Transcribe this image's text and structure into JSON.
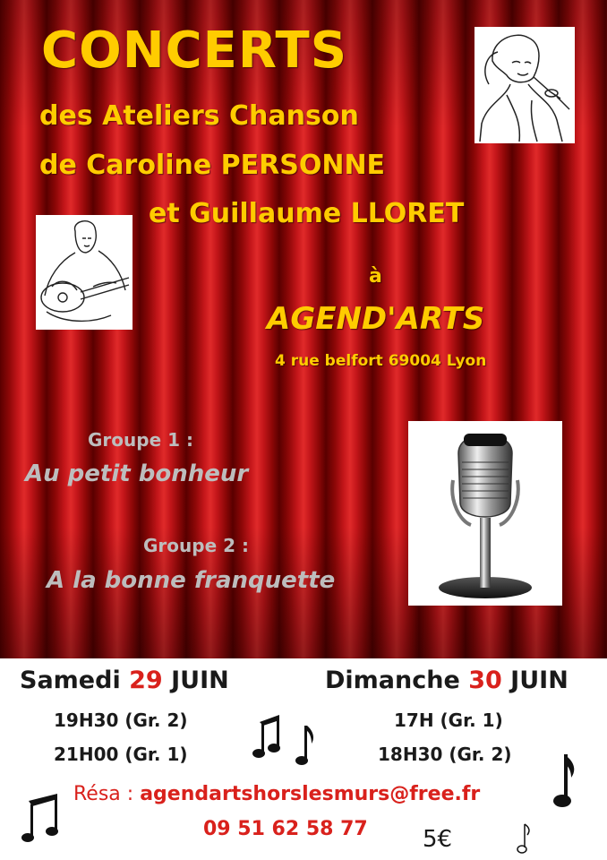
{
  "header": {
    "title": "CONCERTS",
    "line1": "des Ateliers Chanson",
    "line2": "de  Caroline PERSONNE",
    "line3": "et  Guillaume LLORET"
  },
  "venue": {
    "preposition": "à",
    "name": "AGEND'ARTS",
    "address": "4 rue belfort 69004  Lyon"
  },
  "groups": [
    {
      "label": "Groupe 1 :",
      "name": "Au petit bonheur"
    },
    {
      "label": "Groupe 2 :",
      "name": "A la bonne franquette"
    }
  ],
  "dates": [
    {
      "day": "Samedi",
      "num": "29",
      "month": "JUIN",
      "times": [
        "19H30  (Gr. 2)",
        "21H00 (Gr. 1)"
      ]
    },
    {
      "day": "Dimanche",
      "num": "30",
      "month": "JUIN",
      "times": [
        "17H (Gr. 1)",
        "18H30 (Gr. 2)"
      ]
    }
  ],
  "booking": {
    "label": "Résa : ",
    "email": "agendartshorslesmurs@free.fr",
    "phone": "09 51 62 58 77",
    "price": "5€"
  },
  "colors": {
    "title": "#ffcc00",
    "accent": "#d9211c",
    "curtain": "#c4161a"
  },
  "icons": [
    "singer-drawing",
    "guitarist-drawing",
    "vintage-microphone",
    "music-note-icon"
  ]
}
